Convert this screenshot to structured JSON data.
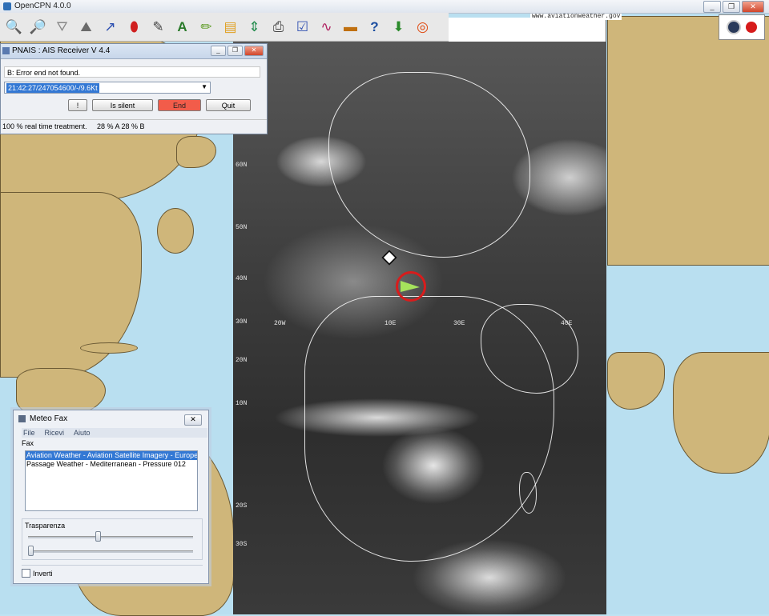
{
  "app": {
    "title": "OpenCPN 4.0.0"
  },
  "window_controls": {
    "min": "_",
    "max": "❐",
    "close": "✕"
  },
  "toolbar": {
    "icons": [
      "zoom-in-icon",
      "zoom-out-icon",
      "funnel-icon",
      "route-icon",
      "track-icon",
      "mob-icon",
      "ruler-icon",
      "text-icon",
      "pencil-icon",
      "layers-icon",
      "scale-icon",
      "print-icon",
      "chart-icon",
      "wave-icon",
      "weather-icon",
      "help-icon",
      "download-icon",
      "lifebuoy-icon"
    ]
  },
  "watermark": "www.aviationweather.gov",
  "pnais": {
    "title": "PNAIS :  AIS  Receiver V 4.4",
    "status": "B: Error end not found.",
    "combo_value": "21:42:27/247054600/-/9.6Kt",
    "buttons": {
      "bang": "!",
      "silent": "Is silent",
      "end": "End",
      "quit": "Quit"
    },
    "footer_left": "100 % real time treatment.",
    "footer_right": "28 % A 28 % B"
  },
  "meteo": {
    "title": "Meteo Fax",
    "menu": {
      "file": "File",
      "ricevi": "Ricevi",
      "aiuto": "Aiuto"
    },
    "fax_label": "Fax",
    "list": [
      "Aviation Weather - Aviation Satellite Imagery - Europe Africa",
      "Passage Weather - Mediterranean - Pressure 012"
    ],
    "transparency_label": "Trasparenza",
    "transparency_value": 0.42,
    "second_slider_value": 0.0,
    "invert_label": "Inverti"
  },
  "grid_labels": [
    "60N",
    "50N",
    "40N",
    "30N",
    "20N",
    "10N",
    "20S",
    "30S",
    "20W",
    "10E",
    "30E",
    "40E"
  ],
  "colors": {
    "ocean": "#b9dff0",
    "land": "#cfb67a",
    "end_button": "#f25c4a",
    "selection": "#3378d4",
    "mob_ring": "#d81c1c",
    "boat": "#a6e35c"
  }
}
